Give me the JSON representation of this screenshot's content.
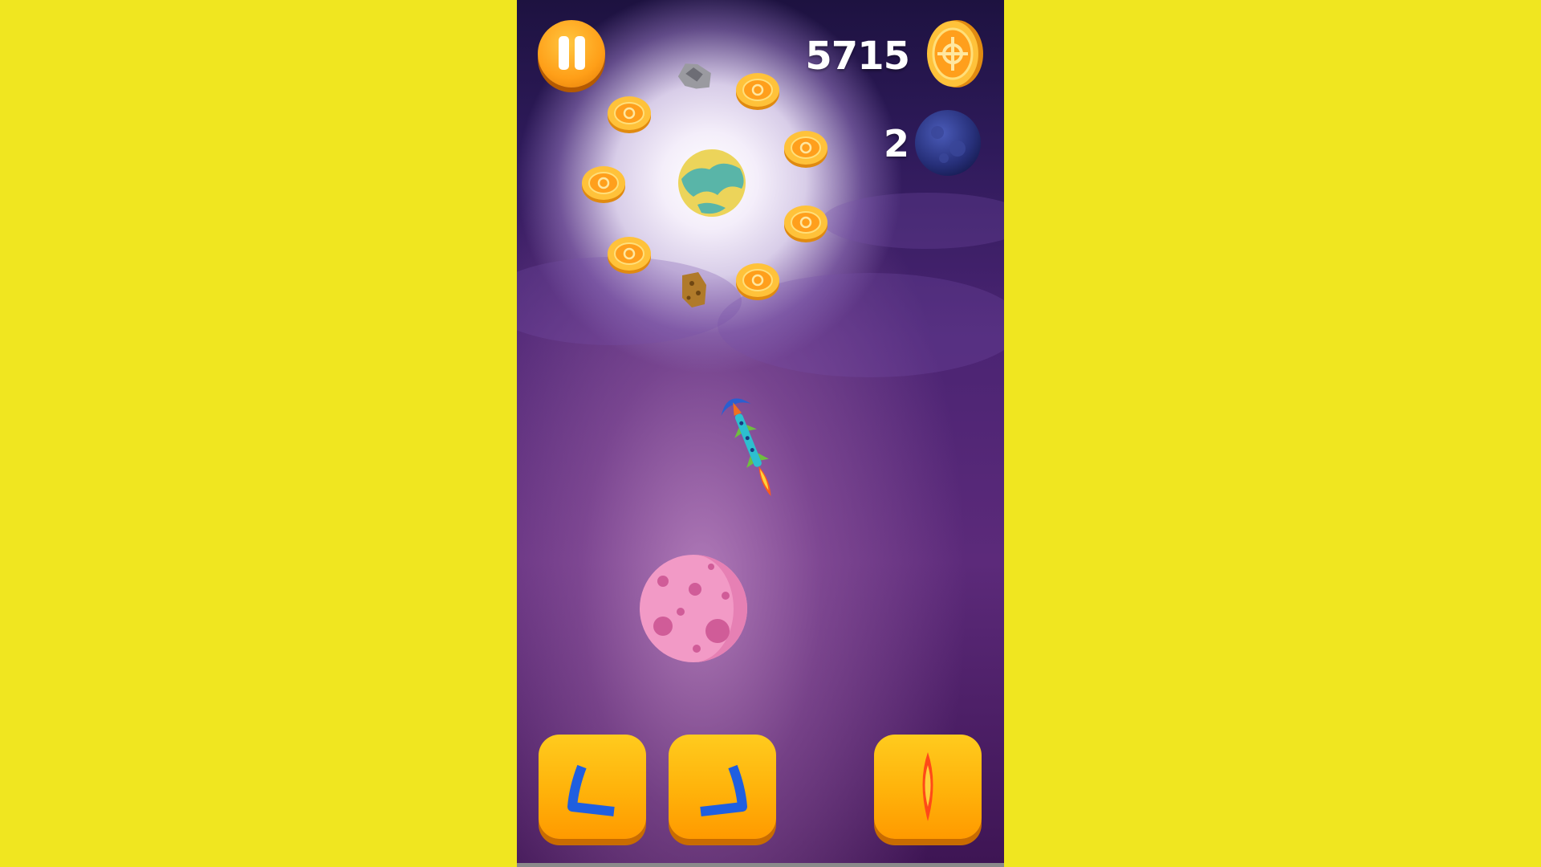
{
  "hud": {
    "score": "5715",
    "planets_remaining": "2"
  },
  "icons": {
    "pause": "pause-icon",
    "coin": "coin-icon",
    "planet": "planet-icon",
    "turn_left": "turn-left-arrow-icon",
    "turn_right": "turn-right-arrow-icon",
    "boost": "flame-boost-icon"
  },
  "colors": {
    "background": "#f0e620",
    "button_orange": "#ffb20a",
    "arrow_blue": "#1f5fe0",
    "space_purple": "#4b2473"
  }
}
